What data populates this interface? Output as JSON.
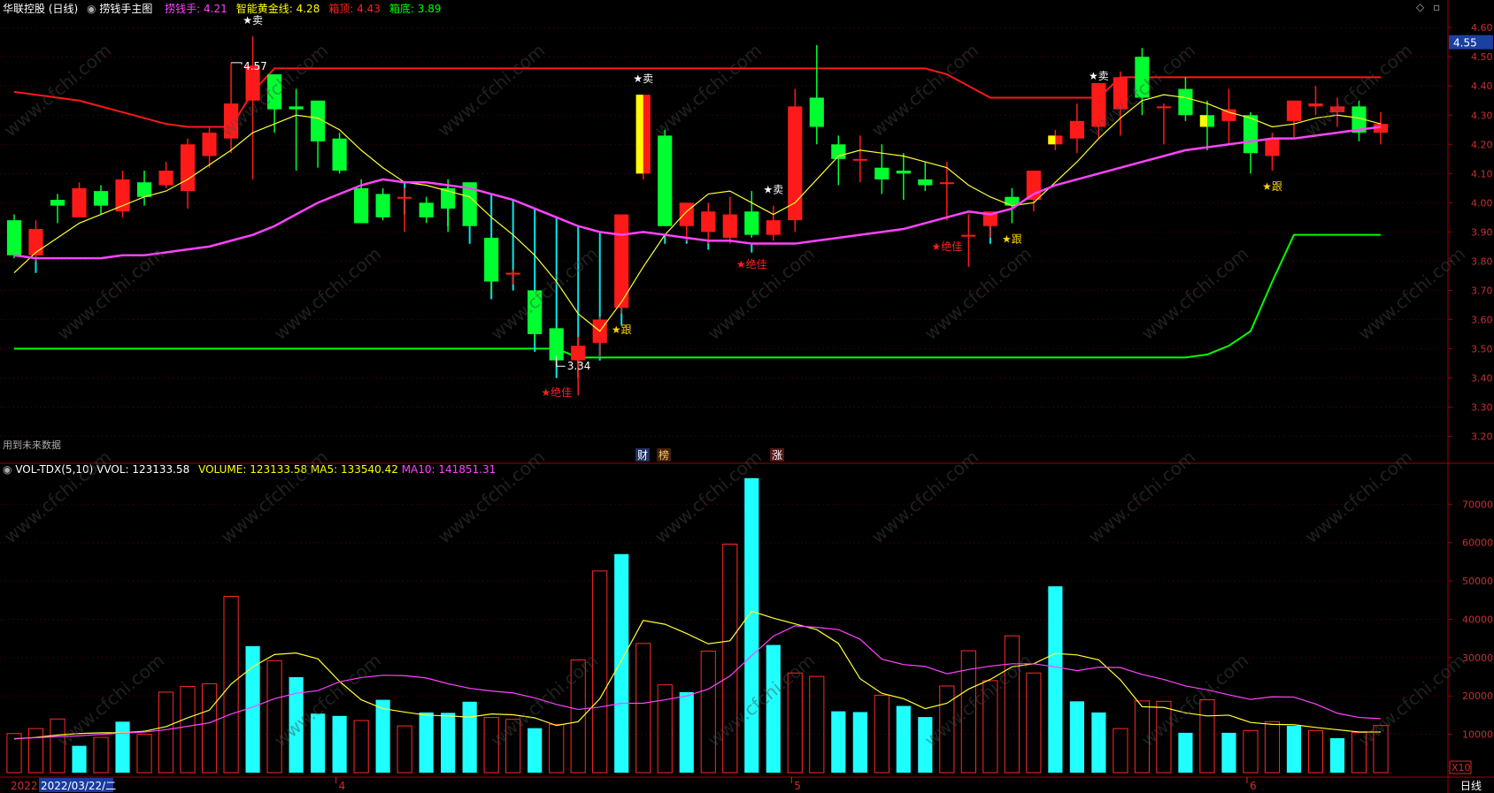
{
  "header": {
    "stock_title": "华联控股 (日线)",
    "indicator_name": "捞钱手主图",
    "items": [
      {
        "label": "捞钱手:",
        "value": "4.21",
        "color": "#ff44ff"
      },
      {
        "label": "智能黄金线:",
        "value": "4.28",
        "color": "#ffff00"
      },
      {
        "label": "箱顶:",
        "value": "4.43",
        "color": "#ff2020"
      },
      {
        "label": "箱底:",
        "value": "3.89",
        "color": "#00ff00"
      }
    ]
  },
  "volume_header": {
    "indicator": "VOL-TDX(5,10)",
    "vvol": "VVOL: 123133.58",
    "volume": "VOLUME: 123133.58",
    "ma5": "MA5: 133540.42",
    "ma10": "MA10: 141851.31"
  },
  "future_data_note": "用到未来数据",
  "event_markers": [
    {
      "text": "财",
      "color": "#ffffff",
      "bg": "#203060"
    },
    {
      "text": "榜",
      "color": "#ffcc66",
      "bg": "#402010"
    },
    {
      "text": "涨",
      "color": "#ffffff",
      "bg": "#501818"
    }
  ],
  "price_axis_labels": [
    "4.60",
    "4.50",
    "4.40",
    "4.30",
    "4.20",
    "4.10",
    "4.00",
    "3.90",
    "3.80",
    "3.70",
    "3.60",
    "3.50",
    "3.40",
    "3.30",
    "3.20"
  ],
  "current_price_tag": "4.55",
  "volume_axis_labels": [
    "70000",
    "60000",
    "50000",
    "40000",
    "30000",
    "20000",
    "10000"
  ],
  "volume_unit": "X10",
  "period_label": "日线",
  "date_axis": {
    "cursor_date": "2022/03/22/二",
    "left_fragment": "2022",
    "months": [
      "4",
      "5",
      "6"
    ]
  },
  "watermark": "www.cfchi.com",
  "annotations": [
    {
      "text": "4.57",
      "type": "high",
      "idx": 10
    },
    {
      "text": "3.34",
      "type": "low",
      "idx": 25
    },
    {
      "text": "★卖",
      "color": "#ffffff",
      "idx": 11,
      "pos": "top"
    },
    {
      "text": "★卖",
      "color": "#ffffff",
      "idx": 29,
      "pos": "top"
    },
    {
      "text": "★卖",
      "color": "#ffffff",
      "idx": 35,
      "pos": "top"
    },
    {
      "text": "★卖",
      "color": "#ffffff",
      "idx": 50,
      "pos": "top"
    },
    {
      "text": "★跟",
      "color": "#ffd700",
      "idx": 28,
      "pos": "low"
    },
    {
      "text": "★跟",
      "color": "#ffd700",
      "idx": 46,
      "pos": "low"
    },
    {
      "text": "★跟",
      "color": "#ffd700",
      "idx": 58,
      "pos": "low"
    },
    {
      "text": "★绝佳",
      "color": "#ff2020",
      "idx": 25,
      "pos": "low"
    },
    {
      "text": "★绝佳",
      "color": "#ff2020",
      "idx": 34,
      "pos": "low"
    },
    {
      "text": "★绝佳",
      "color": "#ff2020",
      "idx": 43,
      "pos": "low"
    }
  ],
  "chart_data": {
    "type": "candlestick",
    "price_range": [
      3.15,
      4.64
    ],
    "volume_range": [
      0,
      77000
    ],
    "candles": [
      [
        3.94,
        3.96,
        3.81,
        3.82
      ],
      [
        3.82,
        3.94,
        3.8,
        3.91
      ],
      [
        4.01,
        4.03,
        3.93,
        3.99
      ],
      [
        3.95,
        4.07,
        3.95,
        4.05
      ],
      [
        4.04,
        4.06,
        3.96,
        3.99
      ],
      [
        3.97,
        4.11,
        3.95,
        4.08
      ],
      [
        4.07,
        4.11,
        3.99,
        4.02
      ],
      [
        4.06,
        4.14,
        4.05,
        4.11
      ],
      [
        4.04,
        4.22,
        3.98,
        4.2
      ],
      [
        4.16,
        4.26,
        4.12,
        4.24
      ],
      [
        4.22,
        4.48,
        4.17,
        4.34
      ],
      [
        4.35,
        4.57,
        4.08,
        4.47
      ],
      [
        4.44,
        4.44,
        4.24,
        4.32
      ],
      [
        4.33,
        4.39,
        4.11,
        4.32
      ],
      [
        4.35,
        4.35,
        4.12,
        4.21
      ],
      [
        4.22,
        4.24,
        4.1,
        4.11
      ],
      [
        4.05,
        4.08,
        3.97,
        3.93
      ],
      [
        4.03,
        4.05,
        3.94,
        3.95
      ],
      [
        4.02,
        4.05,
        3.9,
        4.02
      ],
      [
        4.0,
        4.02,
        3.93,
        3.95
      ],
      [
        4.05,
        4.08,
        3.9,
        3.98
      ],
      [
        4.07,
        4.07,
        3.92,
        3.92
      ],
      [
        3.88,
        3.88,
        3.69,
        3.73
      ],
      [
        3.76,
        3.77,
        3.72,
        3.76
      ],
      [
        3.7,
        3.7,
        3.52,
        3.55
      ],
      [
        3.57,
        3.57,
        3.44,
        3.46
      ],
      [
        3.46,
        3.54,
        3.34,
        3.51
      ],
      [
        3.52,
        3.61,
        3.47,
        3.6
      ],
      [
        3.64,
        3.96,
        3.62,
        3.96
      ],
      [
        4.1,
        4.37,
        4.08,
        4.37
      ],
      [
        4.23,
        4.25,
        3.92,
        3.92
      ],
      [
        3.92,
        4.0,
        3.87,
        4.0
      ],
      [
        3.9,
        4.0,
        3.86,
        3.97
      ],
      [
        3.88,
        4.02,
        3.86,
        3.96
      ],
      [
        3.97,
        4.04,
        3.88,
        3.89
      ],
      [
        3.89,
        3.99,
        3.87,
        3.94
      ],
      [
        3.94,
        4.39,
        3.9,
        4.33
      ],
      [
        4.36,
        4.54,
        4.2,
        4.26
      ],
      [
        4.2,
        4.23,
        4.06,
        4.15
      ],
      [
        4.15,
        4.23,
        4.07,
        4.15
      ],
      [
        4.12,
        4.2,
        4.03,
        4.08
      ],
      [
        4.11,
        4.17,
        4.01,
        4.1
      ],
      [
        4.08,
        4.14,
        4.04,
        4.06
      ],
      [
        4.07,
        4.14,
        3.94,
        4.07
      ],
      [
        3.89,
        3.96,
        3.78,
        3.89
      ],
      [
        3.92,
        3.97,
        3.88,
        3.97
      ],
      [
        4.02,
        4.05,
        3.93,
        3.99
      ],
      [
        4.01,
        4.11,
        3.97,
        4.11
      ],
      [
        4.2,
        4.25,
        4.18,
        4.23
      ],
      [
        4.22,
        4.34,
        4.17,
        4.28
      ],
      [
        4.26,
        4.38,
        4.22,
        4.41
      ],
      [
        4.32,
        4.45,
        4.23,
        4.43
      ],
      [
        4.5,
        4.53,
        4.3,
        4.36
      ],
      [
        4.33,
        4.34,
        4.2,
        4.33
      ],
      [
        4.39,
        4.43,
        4.28,
        4.3
      ],
      [
        4.3,
        4.35,
        4.18,
        4.26
      ],
      [
        4.28,
        4.39,
        4.2,
        4.32
      ],
      [
        4.3,
        4.31,
        4.1,
        4.17
      ],
      [
        4.16,
        4.24,
        4.11,
        4.22
      ],
      [
        4.28,
        4.35,
        4.22,
        4.35
      ],
      [
        4.33,
        4.4,
        4.3,
        4.34
      ],
      [
        4.31,
        4.36,
        4.26,
        4.33
      ],
      [
        4.33,
        4.35,
        4.21,
        4.24
      ],
      [
        4.24,
        4.31,
        4.2,
        4.27
      ]
    ],
    "volume": [
      10200,
      11500,
      14000,
      7000,
      9200,
      13300,
      10000,
      21000,
      22500,
      23200,
      46000,
      33000,
      29200,
      24900,
      15400,
      14800,
      13600,
      19000,
      12200,
      15700,
      15600,
      18500,
      14400,
      13900,
      11600,
      12600,
      29400,
      52600,
      57000,
      33700,
      22900,
      21000,
      31700,
      59600,
      76800,
      33300,
      26000,
      25100,
      16000,
      15800,
      20200,
      17400,
      14500,
      22600,
      31800,
      24000,
      35700,
      26000,
      48600,
      18600,
      15700,
      11500,
      18700,
      18600,
      10400,
      19000,
      10400,
      11000,
      13300,
      12200,
      11000,
      9000,
      10500,
      12300
    ],
    "vol_up": [
      true,
      true,
      true,
      false,
      true,
      false,
      true,
      true,
      true,
      true,
      true,
      false,
      true,
      false,
      false,
      false,
      true,
      false,
      true,
      false,
      false,
      false,
      true,
      true,
      false,
      true,
      true,
      true,
      false,
      true,
      true,
      false,
      true,
      true,
      false,
      false,
      true,
      true,
      false,
      false,
      true,
      false,
      false,
      true,
      true,
      true,
      true,
      true,
      false,
      false,
      false,
      true,
      true,
      true,
      false,
      true,
      false,
      true,
      true,
      false,
      true,
      false,
      true,
      true
    ],
    "ma_gold": [
      3.76,
      3.83,
      3.88,
      3.93,
      3.96,
      3.99,
      4.02,
      4.04,
      4.08,
      4.13,
      4.18,
      4.24,
      4.27,
      4.3,
      4.29,
      4.25,
      4.18,
      4.12,
      4.07,
      4.06,
      4.04,
      4.02,
      3.95,
      3.89,
      3.82,
      3.73,
      3.62,
      3.56,
      3.66,
      3.78,
      3.89,
      3.97,
      4.03,
      4.04,
      4.0,
      3.96,
      4.0,
      4.08,
      4.16,
      4.18,
      4.17,
      4.16,
      4.14,
      4.12,
      4.06,
      4.02,
      3.99,
      4.0,
      4.07,
      4.14,
      4.22,
      4.29,
      4.35,
      4.37,
      4.36,
      4.34,
      4.31,
      4.29,
      4.26,
      4.27,
      4.29,
      4.3,
      4.29,
      4.27
    ],
    "ma_money": [
      3.82,
      3.81,
      3.81,
      3.81,
      3.81,
      3.82,
      3.82,
      3.83,
      3.84,
      3.85,
      3.87,
      3.89,
      3.92,
      3.96,
      4.0,
      4.03,
      4.06,
      4.08,
      4.07,
      4.07,
      4.06,
      4.05,
      4.03,
      4.01,
      3.98,
      3.95,
      3.92,
      3.9,
      3.89,
      3.9,
      3.89,
      3.88,
      3.87,
      3.87,
      3.86,
      3.86,
      3.86,
      3.87,
      3.88,
      3.89,
      3.9,
      3.91,
      3.93,
      3.95,
      3.97,
      3.96,
      3.98,
      4.03,
      4.06,
      4.08,
      4.1,
      4.12,
      4.14,
      4.16,
      4.18,
      4.19,
      4.2,
      4.21,
      4.22,
      4.22,
      4.23,
      4.24,
      4.25,
      4.26
    ],
    "ma_vol5": [
      8800,
      9200,
      9800,
      10200,
      10400,
      10400,
      10800,
      12000,
      14300,
      16300,
      23100,
      27600,
      30800,
      31200,
      29700,
      23800,
      19000,
      16700,
      15800,
      15000,
      14800,
      14500,
      15300,
      15100,
      14300,
      12300,
      13300,
      19300,
      29300,
      39700,
      38700,
      36300,
      33600,
      34400,
      42100,
      40300,
      38800,
      37300,
      33700,
      24500,
      20700,
      19300,
      16700,
      18100,
      21800,
      24300,
      27600,
      28400,
      31100,
      30700,
      29400,
      24200,
      17200,
      17000,
      15600,
      14800,
      15000,
      13100,
      12600,
      12500,
      11800,
      11200,
      10600,
      10600
    ],
    "ma_vol10": [
      8900,
      9100,
      9400,
      9600,
      10000,
      10300,
      10600,
      11200,
      12100,
      13000,
      15300,
      17100,
      19300,
      20700,
      21400,
      23700,
      24800,
      25400,
      25300,
      24700,
      23200,
      22000,
      21300,
      20800,
      19500,
      17800,
      16500,
      17100,
      18100,
      18100,
      19000,
      20000,
      21800,
      25200,
      30500,
      35600,
      38300,
      37900,
      37300,
      34800,
      29600,
      28200,
      27700,
      25800,
      26900,
      27800,
      28400,
      28400,
      27600,
      26600,
      27500,
      27400,
      25600,
      24300,
      22600,
      21600,
      20300,
      19100,
      19800,
      19700,
      17900,
      15500,
      14400,
      14100
    ],
    "box_top": [
      4.38,
      4.37,
      4.36,
      4.35,
      4.33,
      4.31,
      4.29,
      4.27,
      4.26,
      4.26,
      4.26,
      4.38,
      4.46,
      4.46,
      4.46,
      4.46,
      4.46,
      4.46,
      4.46,
      4.46,
      4.46,
      4.46,
      4.46,
      4.46,
      4.46,
      4.46,
      4.46,
      4.46,
      4.46,
      4.46,
      4.46,
      4.46,
      4.46,
      4.46,
      4.46,
      4.46,
      4.46,
      4.46,
      4.46,
      4.46,
      4.46,
      4.46,
      4.46,
      4.44,
      4.4,
      4.36,
      4.36,
      4.36,
      4.36,
      4.36,
      4.36,
      4.43,
      4.43,
      4.43,
      4.43,
      4.43,
      4.43,
      4.43,
      4.43,
      4.43,
      4.43,
      4.43,
      4.43,
      4.43
    ],
    "box_bottom": [
      3.5,
      3.5,
      3.5,
      3.5,
      3.5,
      3.5,
      3.5,
      3.5,
      3.5,
      3.5,
      3.5,
      3.5,
      3.5,
      3.5,
      3.5,
      3.5,
      3.5,
      3.5,
      3.5,
      3.5,
      3.5,
      3.5,
      3.5,
      3.5,
      3.5,
      3.5,
      3.47,
      3.47,
      3.47,
      3.47,
      3.47,
      3.47,
      3.47,
      3.47,
      3.47,
      3.47,
      3.47,
      3.47,
      3.47,
      3.47,
      3.47,
      3.47,
      3.47,
      3.47,
      3.47,
      3.47,
      3.47,
      3.47,
      3.47,
      3.47,
      3.47,
      3.47,
      3.47,
      3.47,
      3.47,
      3.48,
      3.51,
      3.56,
      3.73,
      3.89,
      3.89,
      3.89,
      3.89,
      3.89
    ]
  }
}
